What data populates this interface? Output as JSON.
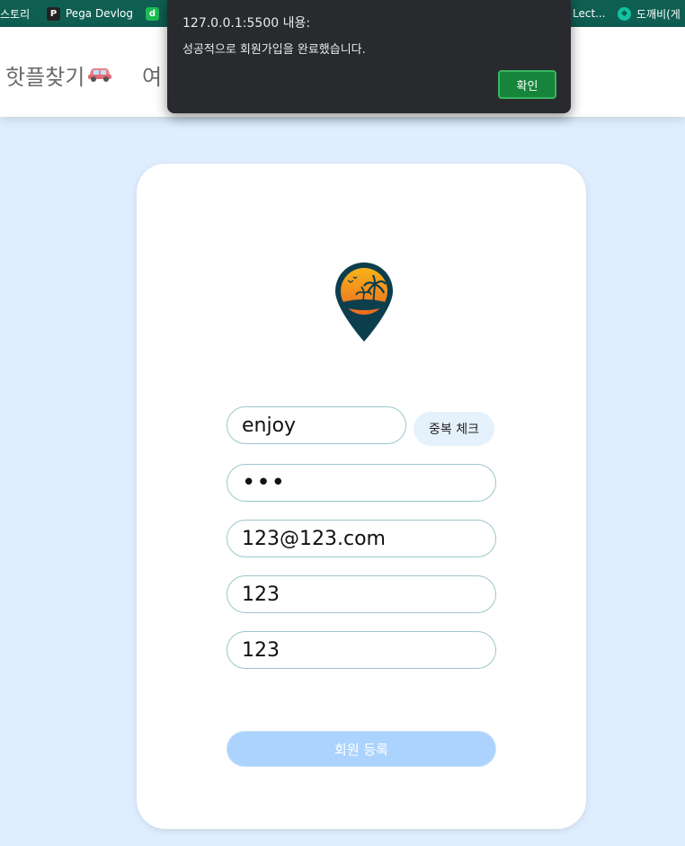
{
  "bookmarks": [
    {
      "label": "스토리",
      "icon": "none"
    },
    {
      "label": "Pega Devlog",
      "icon": "pinterest-icon"
    },
    {
      "label": "",
      "icon": "d-icon"
    },
    {
      "label": "Lect...",
      "icon": "none"
    },
    {
      "label": "도깨비(게",
      "icon": "dokkaebi-icon"
    }
  ],
  "navbar": {
    "brand": "핫플찾기",
    "item_partial": "여"
  },
  "alert": {
    "title": "127.0.0.1:5500 내용:",
    "message": "성공적으로 회원가입을 완료했습니다.",
    "ok_label": "확인"
  },
  "form": {
    "username_value": "enjoy",
    "dup_check_label": "중복 체크",
    "password_value": "•••",
    "email_value": "123@123.com",
    "field4_value": "123",
    "field5_value": "123",
    "submit_label": "회원 등록"
  },
  "colors": {
    "bookmarks_bg": "#0f5e52",
    "page_bg": "#dfeefe",
    "alert_bg": "#292a2d",
    "ok_button": "#16843b",
    "submit_button": "#acd3fd",
    "field_border": "#9cc6cb"
  }
}
